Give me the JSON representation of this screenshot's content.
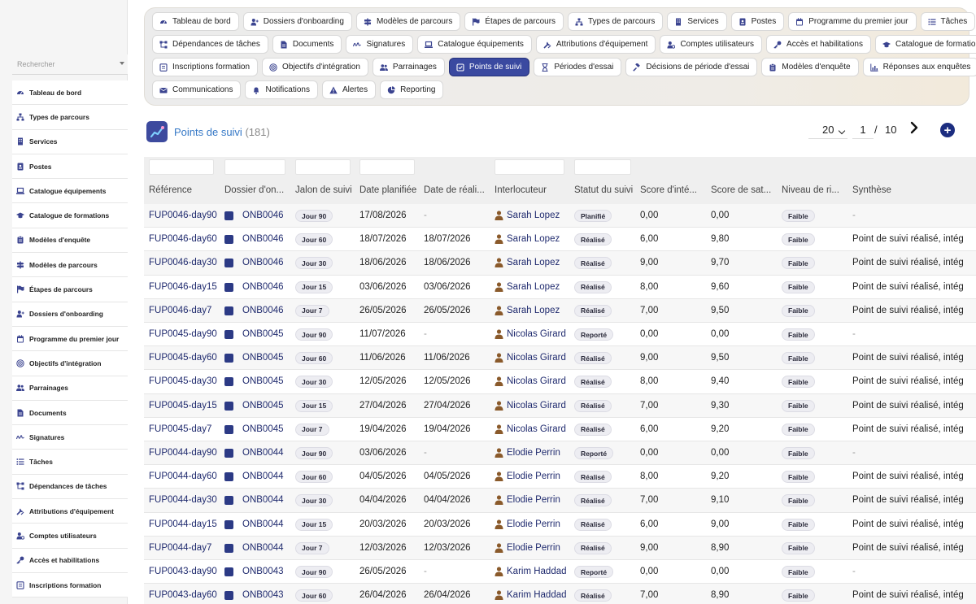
{
  "sidebar": {
    "search_placeholder": "Rechercher",
    "items": [
      {
        "label": "Tableau de bord",
        "icon": "dashboard-icon"
      },
      {
        "label": "Types de parcours",
        "icon": "sitemap-icon"
      },
      {
        "label": "Services",
        "icon": "building-icon"
      },
      {
        "label": "Postes",
        "icon": "id-card-icon"
      },
      {
        "label": "Catalogue équipements",
        "icon": "laptop-icon"
      },
      {
        "label": "Catalogue de formations",
        "icon": "graduation-cap-icon"
      },
      {
        "label": "Modèles d'enquête",
        "icon": "clipboard-icon"
      },
      {
        "label": "Modèles de parcours",
        "icon": "signpost-icon"
      },
      {
        "label": "Étapes de parcours",
        "icon": "flag-icon"
      },
      {
        "label": "Dossiers d'onboarding",
        "icon": "user-plus-icon"
      },
      {
        "label": "Programme du premier jour",
        "icon": "calendar-icon"
      },
      {
        "label": "Objectifs d'intégration",
        "icon": "target-icon"
      },
      {
        "label": "Parrainages",
        "icon": "users-icon"
      },
      {
        "label": "Documents",
        "icon": "document-icon"
      },
      {
        "label": "Signatures",
        "icon": "signature-icon"
      },
      {
        "label": "Tâches",
        "icon": "list-icon"
      },
      {
        "label": "Dépendances de tâches",
        "icon": "diagram-icon"
      },
      {
        "label": "Attributions d'équipement",
        "icon": "tools-icon"
      },
      {
        "label": "Comptes utilisateurs",
        "icon": "user-cog-icon"
      },
      {
        "label": "Accès et habilitations",
        "icon": "key-icon"
      },
      {
        "label": "Inscriptions formation",
        "icon": "registration-icon"
      }
    ]
  },
  "tabs": {
    "rows": [
      [
        {
          "label": "Tableau de bord",
          "icon": "dashboard-icon"
        },
        {
          "label": "Dossiers d'onboarding",
          "icon": "user-plus-icon"
        },
        {
          "label": "Modèles de parcours",
          "icon": "signpost-icon"
        },
        {
          "label": "Étapes de parcours",
          "icon": "flag-icon"
        },
        {
          "label": "Types de parcours",
          "icon": "sitemap-icon"
        },
        {
          "label": "Services",
          "icon": "building-icon"
        },
        {
          "label": "Postes",
          "icon": "id-card-icon"
        },
        {
          "label": "Programme du premier jour",
          "icon": "calendar-icon"
        },
        {
          "label": "Tâches",
          "icon": "list-icon"
        }
      ],
      [
        {
          "label": "Dépendances de tâches",
          "icon": "diagram-icon"
        },
        {
          "label": "Documents",
          "icon": "document-icon"
        },
        {
          "label": "Signatures",
          "icon": "signature-icon"
        },
        {
          "label": "Catalogue équipements",
          "icon": "laptop-icon"
        },
        {
          "label": "Attributions d'équipement",
          "icon": "tools-icon"
        },
        {
          "label": "Comptes utilisateurs",
          "icon": "user-cog-icon"
        },
        {
          "label": "Accès et habilitations",
          "icon": "key-icon"
        },
        {
          "label": "Catalogue de formations",
          "icon": "graduation-cap-icon"
        }
      ],
      [
        {
          "label": "Inscriptions formation",
          "icon": "registration-icon"
        },
        {
          "label": "Objectifs d'intégration",
          "icon": "target-icon"
        },
        {
          "label": "Parrainages",
          "icon": "users-icon"
        },
        {
          "label": "Points de suivi",
          "icon": "checkbox-icon",
          "active": true
        },
        {
          "label": "Périodes d'essai",
          "icon": "hourglass-icon"
        },
        {
          "label": "Décisions de période d'essai",
          "icon": "gavel-icon"
        },
        {
          "label": "Modèles d'enquête",
          "icon": "clipboard-icon"
        },
        {
          "label": "Réponses aux enquêtes",
          "icon": "bar-chart-icon"
        }
      ],
      [
        {
          "label": "Communications",
          "icon": "envelope-icon"
        },
        {
          "label": "Notifications",
          "icon": "bell-icon"
        },
        {
          "label": "Alertes",
          "icon": "warning-icon"
        },
        {
          "label": "Reporting",
          "icon": "pie-chart-icon"
        }
      ]
    ]
  },
  "page": {
    "title": "Points de suivi",
    "count": "(181)",
    "page_size": "20",
    "current_page": "1",
    "separator": "/",
    "total_pages": "10",
    "add_symbol": "+"
  },
  "table": {
    "columns": [
      "Référence",
      "Dossier d'on...",
      "Jalon de suivi",
      "Date planifiée",
      "Date de réali...",
      "Interlocuteur",
      "Statut du suivi",
      "Score d'inté...",
      "Score de sat...",
      "Niveau de ri...",
      "Synthèse"
    ],
    "rows": [
      {
        "ref": "FUP0046-day90",
        "dossier": "ONB0046",
        "jalon": "Jour 90",
        "planned": "17/08/2026",
        "done": "-",
        "person": "Sarah Lopez",
        "status": "Planifié",
        "score_int": "0,00",
        "score_sat": "0,00",
        "risk": "Faible",
        "summary": "-"
      },
      {
        "ref": "FUP0046-day60",
        "dossier": "ONB0046",
        "jalon": "Jour 60",
        "planned": "18/07/2026",
        "done": "18/07/2026",
        "person": "Sarah Lopez",
        "status": "Réalisé",
        "score_int": "6,00",
        "score_sat": "9,80",
        "risk": "Faible",
        "summary": "Point de suivi réalisé, intég"
      },
      {
        "ref": "FUP0046-day30",
        "dossier": "ONB0046",
        "jalon": "Jour 30",
        "planned": "18/06/2026",
        "done": "18/06/2026",
        "person": "Sarah Lopez",
        "status": "Réalisé",
        "score_int": "9,00",
        "score_sat": "9,70",
        "risk": "Faible",
        "summary": "Point de suivi réalisé, intég"
      },
      {
        "ref": "FUP0046-day15",
        "dossier": "ONB0046",
        "jalon": "Jour 15",
        "planned": "03/06/2026",
        "done": "03/06/2026",
        "person": "Sarah Lopez",
        "status": "Réalisé",
        "score_int": "8,00",
        "score_sat": "9,60",
        "risk": "Faible",
        "summary": "Point de suivi réalisé, intég"
      },
      {
        "ref": "FUP0046-day7",
        "dossier": "ONB0046",
        "jalon": "Jour 7",
        "planned": "26/05/2026",
        "done": "26/05/2026",
        "person": "Sarah Lopez",
        "status": "Réalisé",
        "score_int": "7,00",
        "score_sat": "9,50",
        "risk": "Faible",
        "summary": "Point de suivi réalisé, intég"
      },
      {
        "ref": "FUP0045-day90",
        "dossier": "ONB0045",
        "jalon": "Jour 90",
        "planned": "11/07/2026",
        "done": "-",
        "person": "Nicolas Girard",
        "status": "Reporté",
        "score_int": "0,00",
        "score_sat": "0,00",
        "risk": "Faible",
        "summary": "-"
      },
      {
        "ref": "FUP0045-day60",
        "dossier": "ONB0045",
        "jalon": "Jour 60",
        "planned": "11/06/2026",
        "done": "11/06/2026",
        "person": "Nicolas Girard",
        "status": "Réalisé",
        "score_int": "9,00",
        "score_sat": "9,50",
        "risk": "Faible",
        "summary": "Point de suivi réalisé, intég"
      },
      {
        "ref": "FUP0045-day30",
        "dossier": "ONB0045",
        "jalon": "Jour 30",
        "planned": "12/05/2026",
        "done": "12/05/2026",
        "person": "Nicolas Girard",
        "status": "Réalisé",
        "score_int": "8,00",
        "score_sat": "9,40",
        "risk": "Faible",
        "summary": "Point de suivi réalisé, intég"
      },
      {
        "ref": "FUP0045-day15",
        "dossier": "ONB0045",
        "jalon": "Jour 15",
        "planned": "27/04/2026",
        "done": "27/04/2026",
        "person": "Nicolas Girard",
        "status": "Réalisé",
        "score_int": "7,00",
        "score_sat": "9,30",
        "risk": "Faible",
        "summary": "Point de suivi réalisé, intég"
      },
      {
        "ref": "FUP0045-day7",
        "dossier": "ONB0045",
        "jalon": "Jour 7",
        "planned": "19/04/2026",
        "done": "19/04/2026",
        "person": "Nicolas Girard",
        "status": "Réalisé",
        "score_int": "6,00",
        "score_sat": "9,20",
        "risk": "Faible",
        "summary": "Point de suivi réalisé, intég"
      },
      {
        "ref": "FUP0044-day90",
        "dossier": "ONB0044",
        "jalon": "Jour 90",
        "planned": "03/06/2026",
        "done": "-",
        "person": "Elodie Perrin",
        "status": "Reporté",
        "score_int": "0,00",
        "score_sat": "0,00",
        "risk": "Faible",
        "summary": "-"
      },
      {
        "ref": "FUP0044-day60",
        "dossier": "ONB0044",
        "jalon": "Jour 60",
        "planned": "04/05/2026",
        "done": "04/05/2026",
        "person": "Elodie Perrin",
        "status": "Réalisé",
        "score_int": "8,00",
        "score_sat": "9,20",
        "risk": "Faible",
        "summary": "Point de suivi réalisé, intég"
      },
      {
        "ref": "FUP0044-day30",
        "dossier": "ONB0044",
        "jalon": "Jour 30",
        "planned": "04/04/2026",
        "done": "04/04/2026",
        "person": "Elodie Perrin",
        "status": "Réalisé",
        "score_int": "7,00",
        "score_sat": "9,10",
        "risk": "Faible",
        "summary": "Point de suivi réalisé, intég"
      },
      {
        "ref": "FUP0044-day15",
        "dossier": "ONB0044",
        "jalon": "Jour 15",
        "planned": "20/03/2026",
        "done": "20/03/2026",
        "person": "Elodie Perrin",
        "status": "Réalisé",
        "score_int": "6,00",
        "score_sat": "9,00",
        "risk": "Faible",
        "summary": "Point de suivi réalisé, intég"
      },
      {
        "ref": "FUP0044-day7",
        "dossier": "ONB0044",
        "jalon": "Jour 7",
        "planned": "12/03/2026",
        "done": "12/03/2026",
        "person": "Elodie Perrin",
        "status": "Réalisé",
        "score_int": "9,00",
        "score_sat": "8,90",
        "risk": "Faible",
        "summary": "Point de suivi réalisé, intég"
      },
      {
        "ref": "FUP0043-day90",
        "dossier": "ONB0043",
        "jalon": "Jour 90",
        "planned": "26/05/2026",
        "done": "-",
        "person": "Karim Haddad",
        "status": "Reporté",
        "score_int": "0,00",
        "score_sat": "0,00",
        "risk": "Faible",
        "summary": "-"
      },
      {
        "ref": "FUP0043-day60",
        "dossier": "ONB0043",
        "jalon": "Jour 60",
        "planned": "26/04/2026",
        "done": "26/04/2026",
        "person": "Karim Haddad",
        "status": "Réalisé",
        "score_int": "7,00",
        "score_sat": "8,90",
        "risk": "Faible",
        "summary": "Point de suivi réalisé, intég"
      }
    ]
  }
}
